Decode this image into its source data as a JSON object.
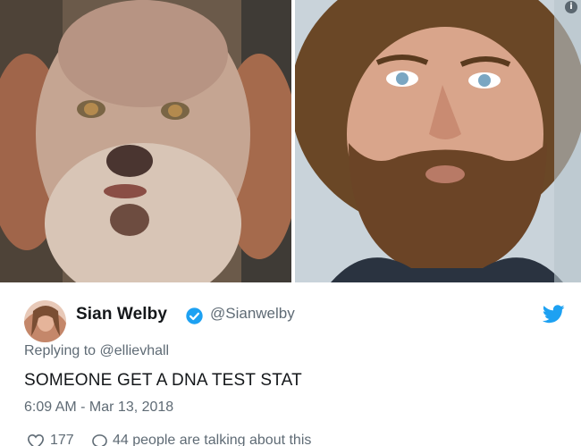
{
  "photos": {
    "left_icon": "dog-face-photo",
    "right_icon": "bearded-man-photo",
    "info_badge_icon": "info-icon"
  },
  "author": {
    "name": "Sian Welby",
    "handle": "@Sianwelby",
    "verified_icon": "verified-badge-icon",
    "avatar_icon": "avatar-photo"
  },
  "brand": {
    "icon": "twitter-bird-icon",
    "color": "#1da1f2"
  },
  "tweet": {
    "replying_label": "Replying to",
    "replying_to": "@ellievhall",
    "text": "SOMEONE GET A DNA TEST STAT",
    "timestamp": "6:09 AM - Mar 13, 2018"
  },
  "actions": {
    "like_count": "177",
    "talking_text": "44 people are talking about this"
  }
}
